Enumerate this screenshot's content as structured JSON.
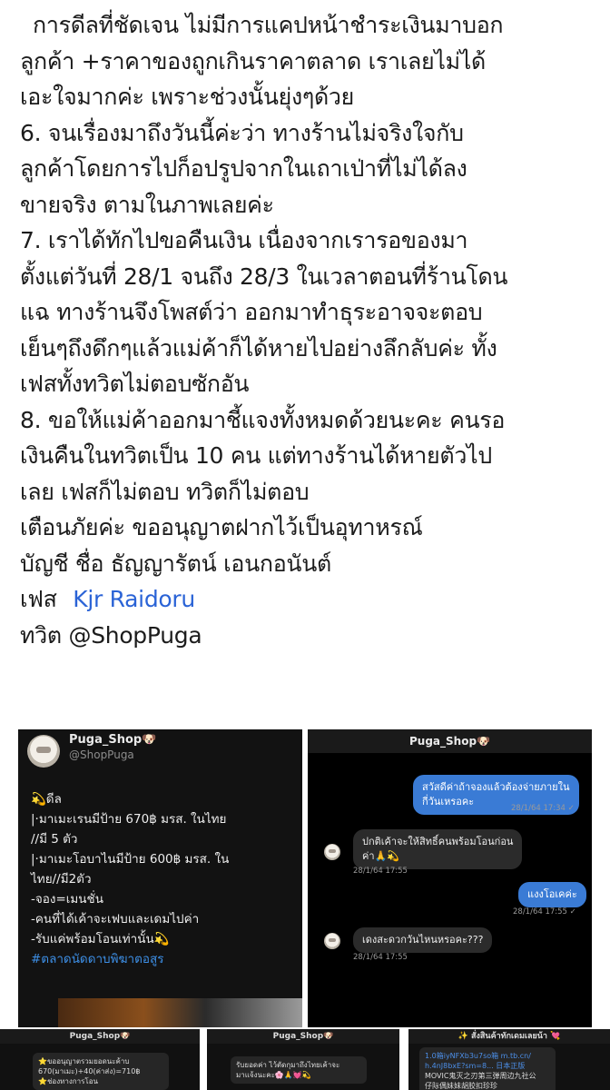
{
  "post": {
    "lines": [
      "การดีลที่ชัดเจน ไม่มีการแคปหน้าชำระเงินมาบอก",
      "ลูกค้า +ราคาของถูกเกินราคาตลาด เราเลยไม่ได้",
      "เอะใจมากค่ะ เพราะช่วงนั้นยุ่งๆด้วย",
      "6. จนเรื่องมาถึงวันนี้ค่ะว่า ทางร้านไม่จริงใจกับ",
      "ลูกค้าโดยการไปก็อปรูปจากในเถาเป่าที่ไม่ได้ลง",
      "ขายจริง ตามในภาพเลยค่ะ",
      "7. เราได้ทักไปขอคืนเงิน เนื่องจากเรารอของมา",
      "ตั้งแต่วันที่ 28/1 จนถึง 28/3  ในเวลาตอนที่ร้านโดน",
      "แฉ ทางร้านจึงโพสต์ว่า ออกมาทำธุระอาจจะตอบ",
      "เย็นๆถึงดึกๆแล้วแม่ค้าก็ได้หายไปอย่างลึกลับค่ะ ทั้ง",
      "เฟสทั้งทวิตไม่ตอบซักอัน",
      "8. ขอให้แม่ค้าออกมาชี้แจงทั้งหมดด้วยนะคะ คนรอ",
      "เงินคืนในทวิตเป็น 10 คน แต่ทางร้านได้หายตัวไป",
      "เลย เฟสก็ไม่ตอบ ทวิตก็ไม่ตอบ",
      "เตือนภัยค่ะ  ขออนุญาตฝากไว้เป็นอุทาหรณ์",
      "บัญชี ชื่อ ธัญญารัตน์ เอนกอนันต์"
    ],
    "facebook_label": "เฟส",
    "facebook_link": "Kjr Raidoru",
    "twitter_line": "ทวิต @ShopPuga"
  },
  "screenshot_1": {
    "name": "Puga_Shop🐶",
    "handle": "@ShopPuga",
    "lines": [
      "💫ดีล",
      "|·มาเมะเรนมีป้าย 670฿ มรส. ในไทย",
      "//มี 5 ตัว",
      "|·มาเมะโอบาไนมีป้าย 600฿ มรส. ใน",
      "ไทย//มี2ตัว",
      "-จอง=เมนชั่น",
      "-คนที่ได้เค้าจะเฟบและเดมไปค่า",
      "-รับแค่พร้อมโอนเท่านั้น💫"
    ],
    "hashtag": "#ตลาดนัดดาบพิฆาตอสูร"
  },
  "screenshot_2": {
    "title": "Puga_Shop🐶",
    "msg1_line1": "สวัสดีค่าถ้าจองแล้วต้องจ่ายภายใน",
    "msg1_line2": "กี่วันเหรอคะ",
    "msg1_time": "28/1/64 17:34 ✓",
    "msg2_line1": "ปกติเค้าจะให้สิทธิ์คนพร้อมโอนก่อน",
    "msg2_line2": "ค่า🙏💫",
    "msg2_time": "28/1/64 17:55",
    "msg3": "แงงโอเคค่ะ",
    "msg3_time": "28/1/64 17:55 ✓",
    "msg4": "เดงสะดวกวันไหนหรอคะ???",
    "msg4_time": "28/1/64 17:55"
  },
  "thumb_1": {
    "title": "Puga_Shop🐶",
    "line1": "⭐ขออนุญาตรวมยอดนะค้าบ",
    "line2": "670(มาเมะ)+40(ค่าส่ง)=710฿",
    "line3": "⭐ช่องทางการโอน"
  },
  "thumb_2": {
    "title": "Puga_Shop🐶",
    "line1": "รับยอดค่า ไว้ตัดกุมาถึงไทยเค้าจะ",
    "line2": "มาแจ้งนะคะ🌸🙏💓💫"
  },
  "thumb_3": {
    "title": "✨ สั่งสินค้าทักเดมเลยน้า 💘",
    "line1": "1.0箱iyNFXb3u7so箱 m.tb.cn/",
    "line2": "h.4nJ8bxE?sm=8... 日本正版",
    "line3": "MOVIC鬼灭之刃第三弹周边九社公",
    "line4": "仔际偶妹妹胡胶扣珍珍"
  }
}
